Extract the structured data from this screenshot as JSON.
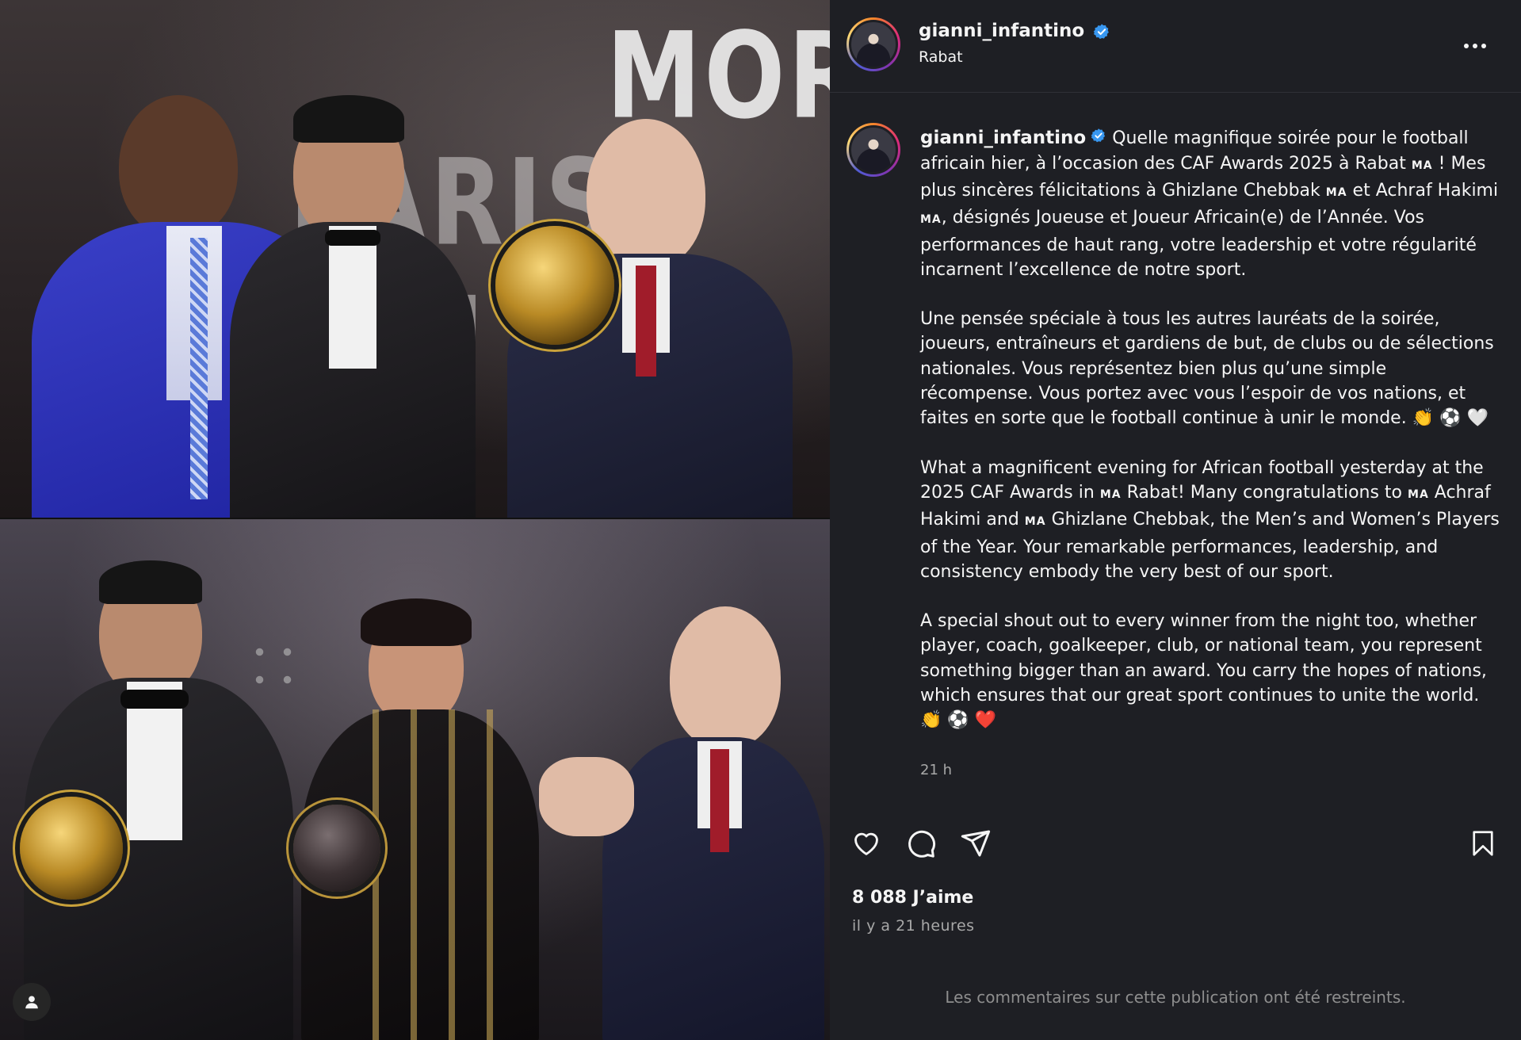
{
  "post": {
    "username": "gianni_infantino",
    "location": "Rabat",
    "verified_icon": "verified-badge-icon",
    "more_icon": "more-options-icon"
  },
  "caption": {
    "username": "gianni_infantino",
    "p1_a": "Quelle magnifique soirée pour le football africain hier, à l’occasion des CAF Awards 2025 à Rabat ",
    "flag": "MA",
    "p1_b": " ! Mes plus sincères félicitations à Ghizlane Chebbak ",
    "p1_c": " et Achraf Hakimi ",
    "p1_d": ", désignés Joueuse et Joueur Africain(e) de l’Année. Vos performances de haut rang, votre leadership et votre régularité incarnent l’excellence de notre sport.",
    "p2": "Une pensée spéciale à tous les autres lauréats de la soirée, joueurs, entraîneurs et gardiens de but, de clubs ou de sélections nationales. Vous représentez bien plus qu’une simple récompense. Vous portez avec vous l’espoir de vos nations, et faites en sorte que le football continue à unir le monde. 👏 ⚽ 🤍",
    "p3_a": "What a magnificent evening for African football yesterday at the 2025 CAF Awards in ",
    "p3_b": " Rabat! Many congratulations to ",
    "p3_c": " Achraf Hakimi and ",
    "p3_d": " Ghizlane Chebbak, the Men’s and Women’s Players of the Year. Your remarkable performances, leadership, and consistency embody the very best of our sport.",
    "p4": "A special shout out to every winner from the night too, whether player, coach, goalkeeper, club, or national team, you represent something bigger than an award. You carry the hopes of nations, which ensures that our great sport continues to unite the world. 👏 ⚽ ❤️",
    "time": "21 h"
  },
  "actions": {
    "like_icon": "heart-icon",
    "comment_icon": "comment-icon",
    "share_icon": "share-icon",
    "save_icon": "bookmark-icon"
  },
  "stats": {
    "likes": "8 088 J’aime",
    "posted": "il y a 21 heures"
  },
  "comments_notice": "Les commentaires sur cette publication ont été restreints.",
  "photo": {
    "background_text_line1": "MOR",
    "background_text_line2": "PARIS   AIN"
  },
  "colors": {
    "panel_bg": "#1e1f24",
    "text": "#f5f5f5",
    "muted": "#a8a8a8",
    "verified": "#3897f0"
  }
}
